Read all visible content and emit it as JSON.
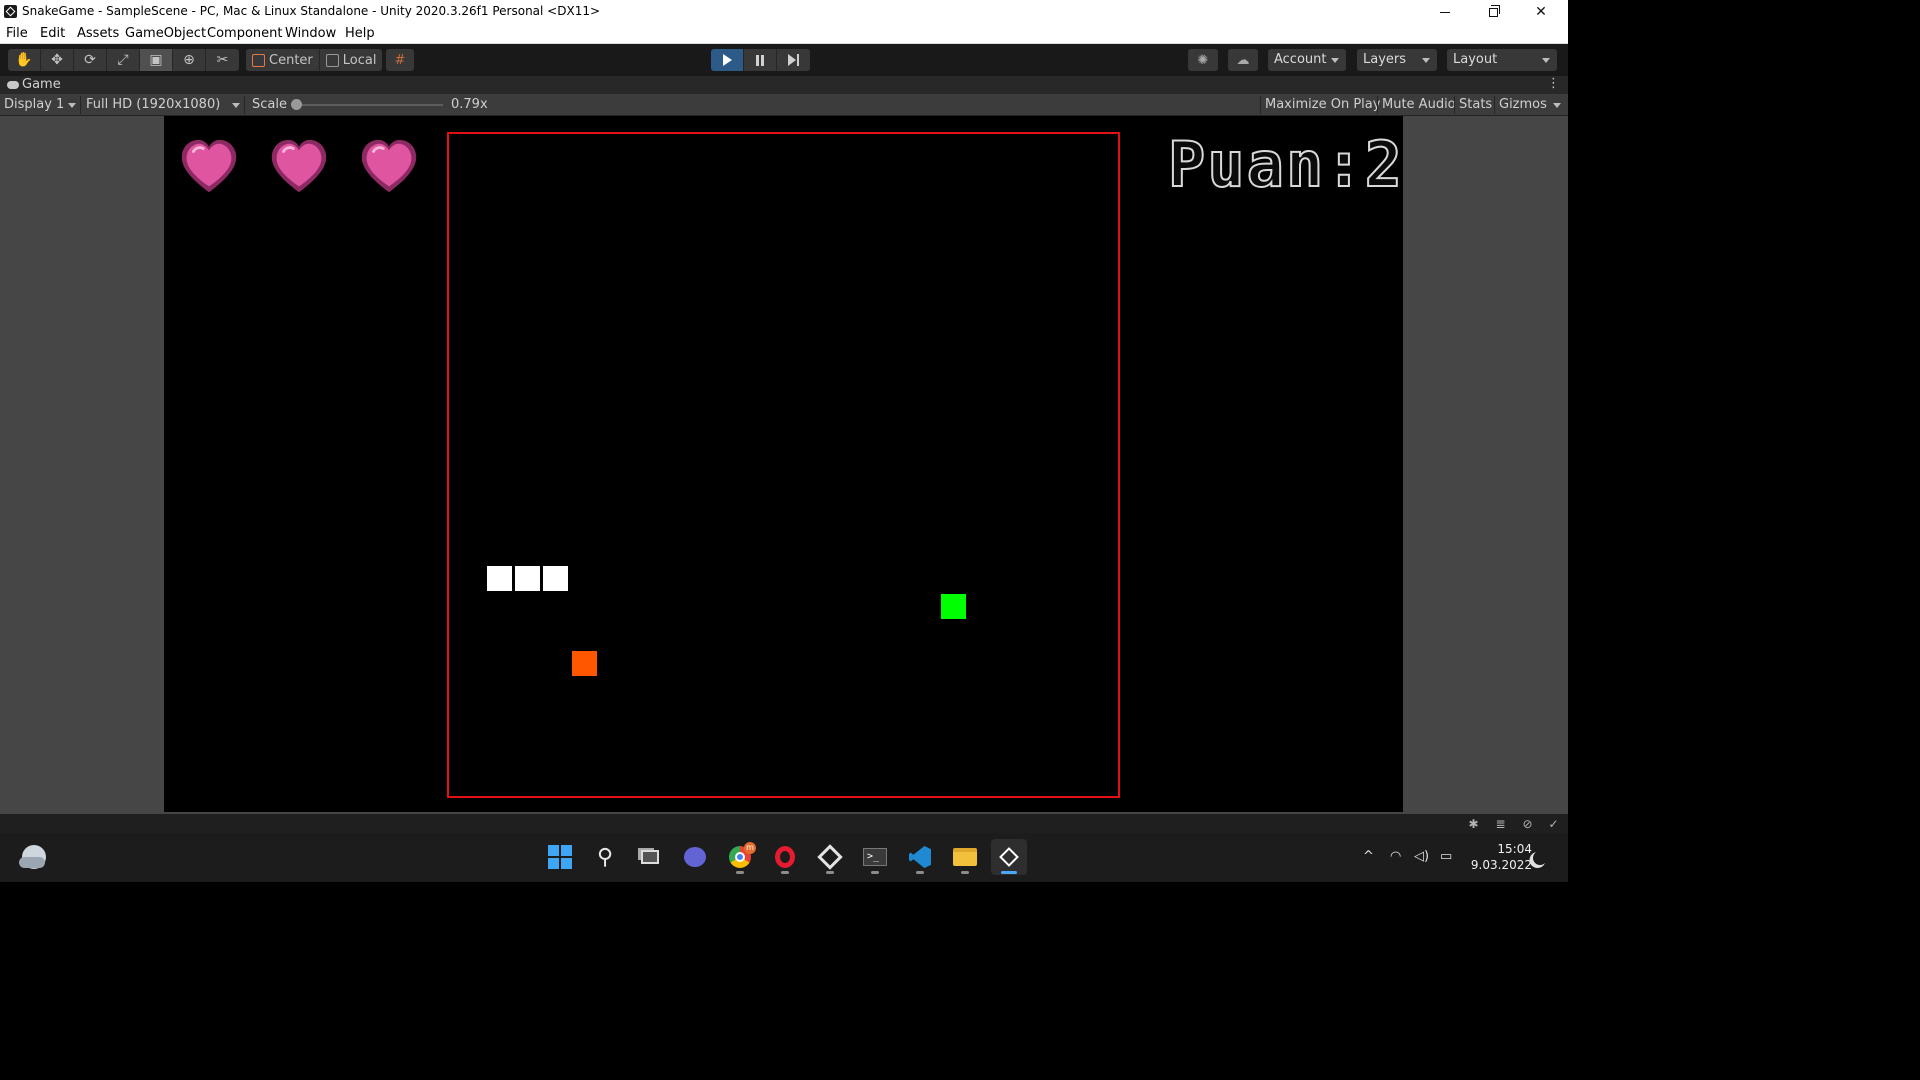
{
  "window": {
    "title": "SnakeGame - SampleScene - PC, Mac & Linux Standalone - Unity 2020.3.26f1 Personal <DX11>",
    "icon": "unity-icon",
    "controls": [
      "minimize-icon",
      "maximize-icon",
      "close-icon"
    ]
  },
  "menubar": {
    "items": [
      "File",
      "Edit",
      "Assets",
      "GameObject",
      "Component",
      "Window",
      "Help"
    ]
  },
  "toolbar": {
    "tools": [
      "hand-tool-icon",
      "move-tool-icon",
      "rotate-tool-icon",
      "scale-tool-icon",
      "rect-tool-icon",
      "transform-tool-icon",
      "custom-tool-icon"
    ],
    "active_tool": "rect-tool-icon",
    "pivot_mode": "Center",
    "pivot_rotation": "Local",
    "play_state": "playing",
    "account_label": "Account",
    "layers_label": "Layers",
    "layout_label": "Layout",
    "accent_color": "#2d5b88"
  },
  "game_tab": {
    "label": "Game",
    "display": "Display 1",
    "resolution": "Full HD (1920x1080)",
    "scale_label": "Scale",
    "scale_value": "0.79x",
    "scale_fraction": 0.0,
    "maximize_on_play": "Maximize On Play",
    "mute_audio": "Mute Audio",
    "stats": "Stats",
    "gizmos": "Gizmos"
  },
  "game": {
    "lives": 3,
    "heart_color": "#e0559f",
    "border_color": "#e20f16",
    "snake_color": "#ffffff",
    "food_colors": [
      "#ff5600",
      "#00ff00"
    ],
    "score_text": "Puan:2"
  },
  "taskbar": {
    "apps": [
      "start-icon",
      "search-icon",
      "task-view-icon",
      "chat-icon",
      "chrome-icon",
      "opera-icon",
      "unity-hub-icon",
      "terminal-icon",
      "vscode-icon",
      "file-explorer-icon",
      "unity-editor-icon"
    ],
    "active_app": "unity-editor-icon",
    "chrome_badge": "m",
    "time": "15:04",
    "date": "9.03.2022"
  }
}
